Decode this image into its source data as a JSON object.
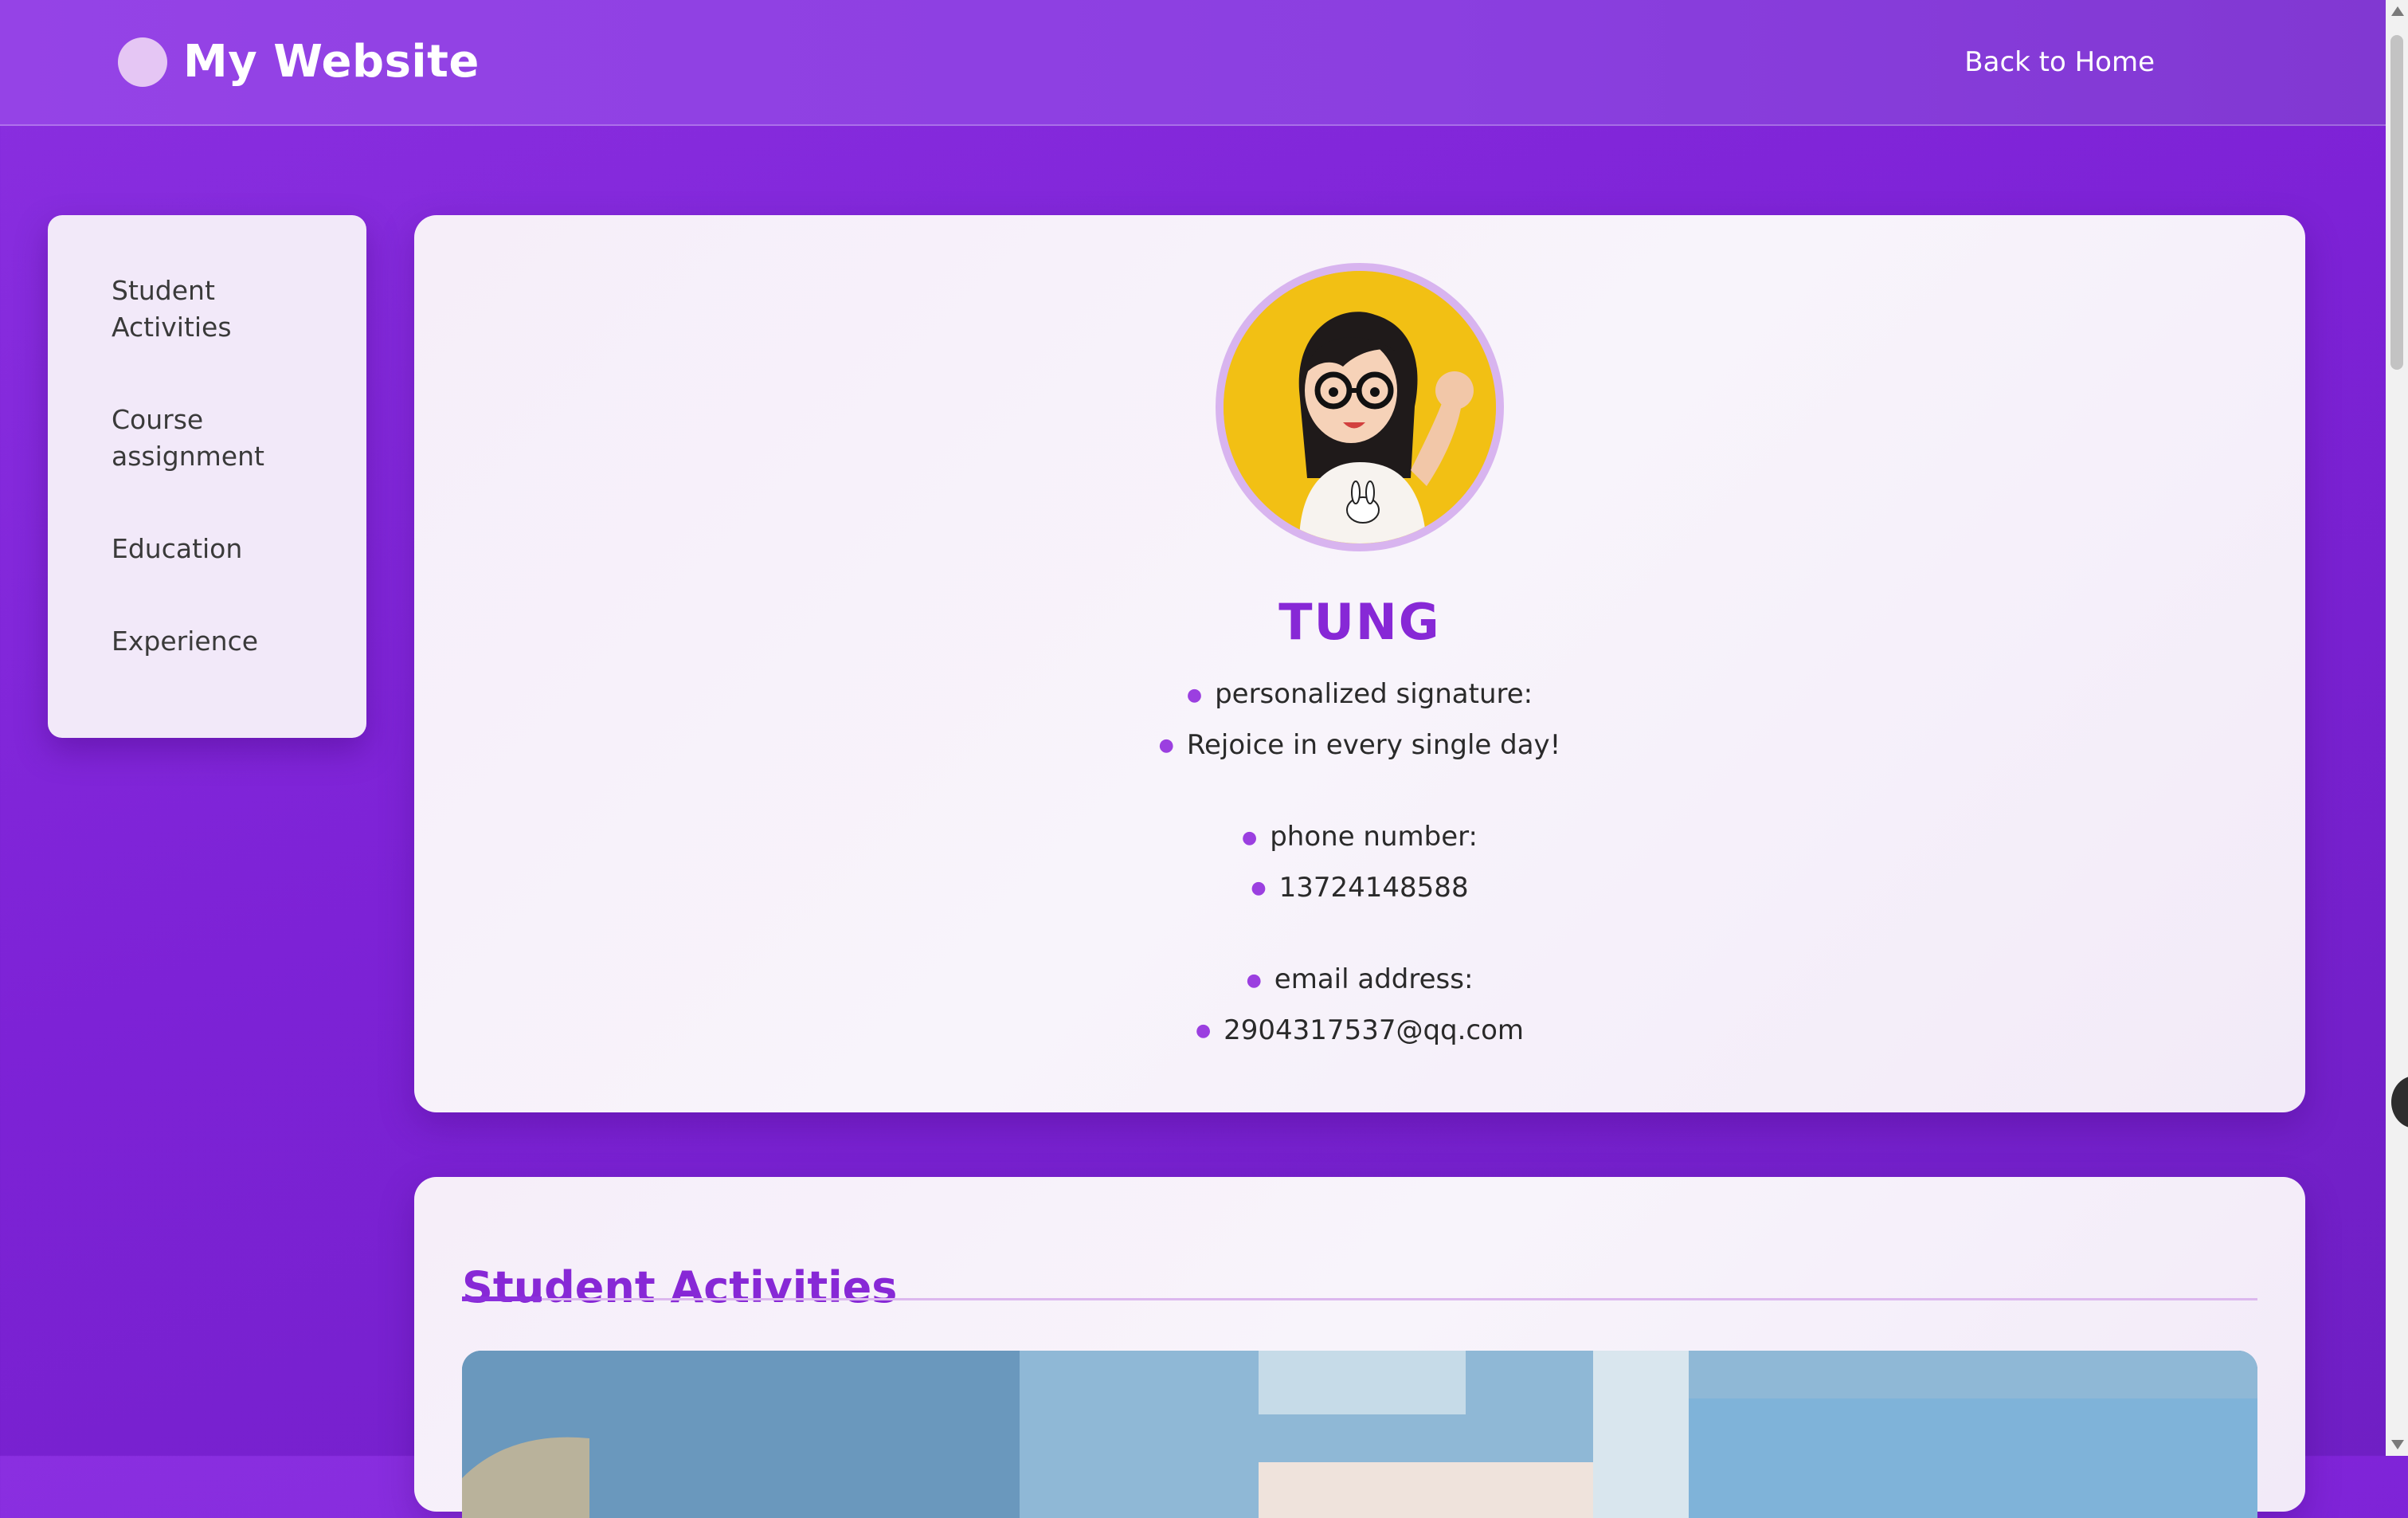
{
  "header": {
    "site_name": "My Website",
    "back_link": "Back to Home"
  },
  "sidebar": {
    "items": [
      {
        "label": "Student Activities"
      },
      {
        "label": "Course assignment"
      },
      {
        "label": "Education"
      },
      {
        "label": "Experience"
      }
    ]
  },
  "profile": {
    "name": "TUNG",
    "signature_label": "personalized signature:",
    "signature_value": "Rejoice in every single day!",
    "phone_label": "phone number:",
    "phone_value": "13724148588",
    "email_label": "email address:",
    "email_value": "2904317537@qq.com"
  },
  "activities": {
    "title": "Student Activities"
  },
  "colors": {
    "background": "#8a2fe0",
    "accent": "#8728d6",
    "card": "#f6eef9",
    "avatar_bg": "#f2c014"
  }
}
